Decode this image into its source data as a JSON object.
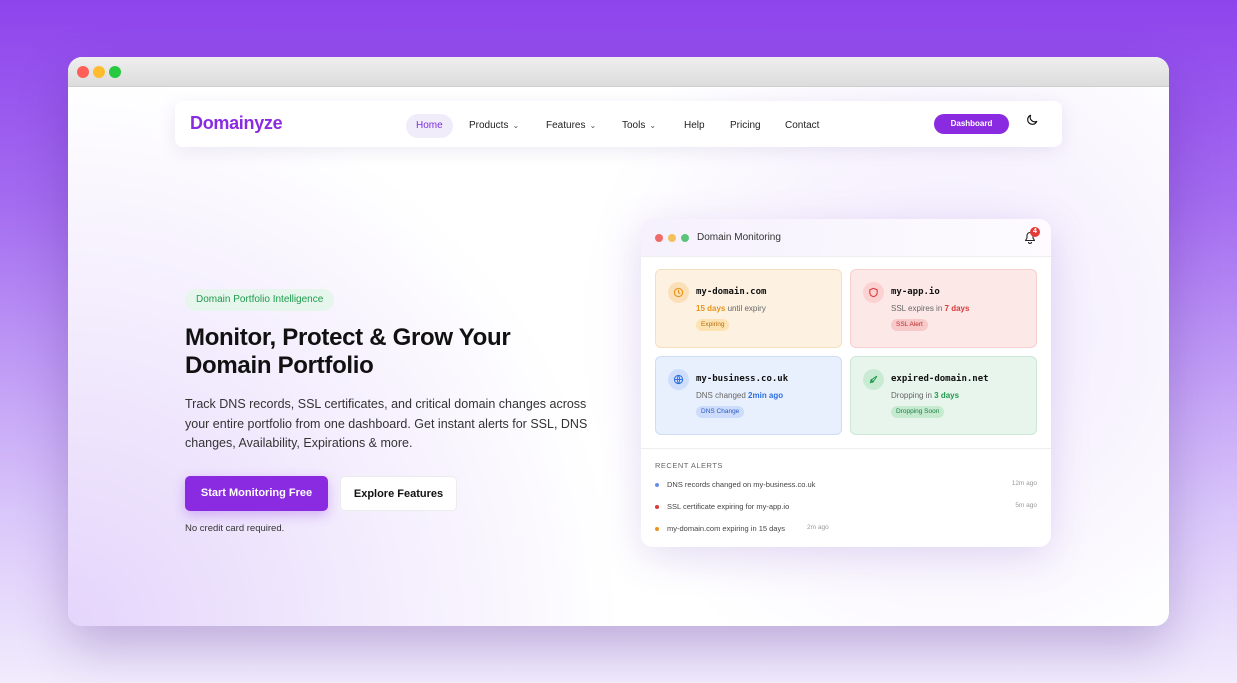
{
  "nav": {
    "logo": "Domainyze",
    "links": [
      {
        "label": "Home",
        "has_caret": false,
        "active": true
      },
      {
        "label": "Products",
        "has_caret": true
      },
      {
        "label": "Features",
        "has_caret": true
      },
      {
        "label": "Tools",
        "has_caret": true
      },
      {
        "label": "Help",
        "has_caret": false
      },
      {
        "label": "Pricing",
        "has_caret": false
      },
      {
        "label": "Contact",
        "has_caret": false
      }
    ],
    "caret": "⌄",
    "dashboard_label": "Dashboard",
    "theme_toggle_icon": "moon-icon"
  },
  "hero": {
    "badge": "Domain Portfolio Intelligence",
    "title_line1": "Monitor, Protect & Grow Your",
    "title_line2": "Domain Portfolio",
    "description": "Track DNS records, SSL certificates, and critical domain changes across your entire portfolio from one dashboard. Get instant alerts for SSL, DNS changes, Availability, Expirations & more.",
    "primary_cta": "Start Monitoring Free",
    "secondary_cta": "Explore Features",
    "note": "No credit card required."
  },
  "dashboard": {
    "title": "Domain Monitoring",
    "notification_count": "4",
    "cards": [
      {
        "domain": "my-domain.com",
        "highlight": "15 days",
        "status_text": " until expiry",
        "status_prefix": "",
        "pill": "Expiring",
        "icon": "clock-icon",
        "bg": "#fdf1e2",
        "border": "#f6dfc0",
        "accent": "#e8941a",
        "icon_bg": "#fbdfb8",
        "pill_bg": "#fde2b2",
        "pill_color": "#b9700d"
      },
      {
        "domain": "my-app.io",
        "highlight": "7 days",
        "status_text": "",
        "status_prefix": "SSL expires in ",
        "pill": "SSL Alert",
        "icon": "shield-icon",
        "bg": "#fde8e8",
        "border": "#f7cfcf",
        "accent": "#d93a3a",
        "icon_bg": "#fbd1d1",
        "pill_bg": "#f8c9c9",
        "pill_color": "#c02a2a"
      },
      {
        "domain": "my-business.co.uk",
        "highlight": "2min ago",
        "status_text": "",
        "status_prefix": "DNS changed ",
        "pill": "DNS Change",
        "icon": "globe-icon",
        "bg": "#e8f0fd",
        "border": "#cfdcf6",
        "accent": "#2f6fe0",
        "icon_bg": "#cfdffb",
        "pill_bg": "#cddcfa",
        "pill_color": "#2a5cc0"
      },
      {
        "domain": "expired-domain.net",
        "highlight": "3 days",
        "status_text": "",
        "status_prefix": "Dropping in ",
        "pill": "Dropping Soon",
        "icon": "rocket-icon",
        "bg": "#e8f5ec",
        "border": "#cde8d5",
        "accent": "#1f9a4d",
        "icon_bg": "#c9ebd3",
        "pill_bg": "#c6ead0",
        "pill_color": "#1b7d3f"
      }
    ],
    "recent_alerts_title": "RECENT ALERTS",
    "alerts": [
      {
        "text": "DNS records changed on my-business.co.uk",
        "time": "12m ago",
        "color": "#6a8ce8",
        "time_align": "right"
      },
      {
        "text": "SSL certificate expiring for my-app.io",
        "time": "5m ago",
        "color": "#d93a3a",
        "time_align": "right"
      },
      {
        "text": "my-domain.com expiring in 15 days",
        "time": "2m ago",
        "color": "#e8941a",
        "time_align": "inline"
      }
    ]
  }
}
